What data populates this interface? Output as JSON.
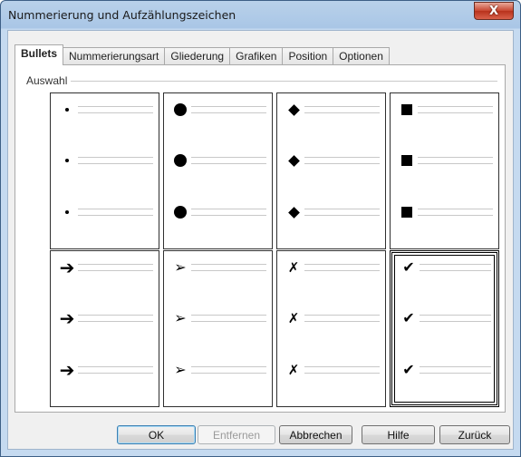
{
  "window": {
    "title": "Nummerierung und Aufzählungszeichen",
    "close_label": "X"
  },
  "tabs": [
    {
      "label": "Bullets",
      "active": true
    },
    {
      "label": "Nummerierungsart",
      "active": false
    },
    {
      "label": "Gliederung",
      "active": false
    },
    {
      "label": "Grafiken",
      "active": false
    },
    {
      "label": "Position",
      "active": false
    },
    {
      "label": "Optionen",
      "active": false
    }
  ],
  "selection_group": {
    "label": "Auswahl",
    "styles": [
      {
        "name": "small-dot",
        "glyph": "",
        "selected": false
      },
      {
        "name": "large-dot",
        "glyph": "",
        "selected": false
      },
      {
        "name": "diamond",
        "glyph": "",
        "selected": false
      },
      {
        "name": "square",
        "glyph": "",
        "selected": false
      },
      {
        "name": "arrow",
        "glyph": "➔",
        "selected": false
      },
      {
        "name": "arrowhead",
        "glyph": "➢",
        "selected": false
      },
      {
        "name": "x-mark",
        "glyph": "✗",
        "selected": false
      },
      {
        "name": "check-mark",
        "glyph": "✔",
        "selected": true
      }
    ]
  },
  "buttons": {
    "ok": "OK",
    "remove": "Entfernen",
    "cancel": "Abbrechen",
    "help": "Hilfe",
    "reset": "Zurück"
  },
  "colors": {
    "title_bar": "#b9d1ea",
    "close_button": "#c8452f",
    "default_button_border": "#3c7fb1"
  }
}
